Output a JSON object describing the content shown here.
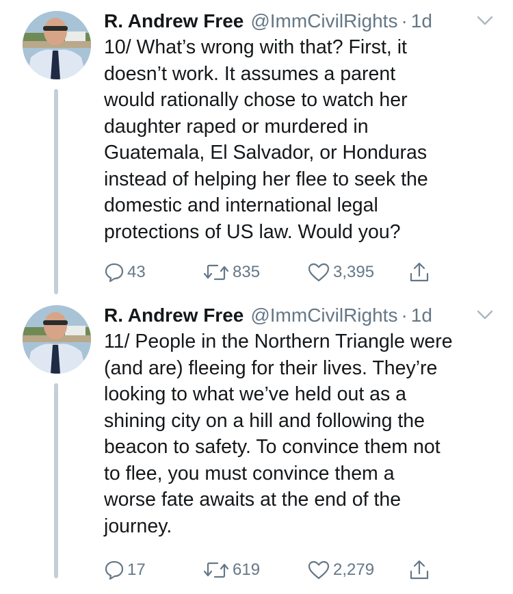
{
  "colors": {
    "text": "#14171a",
    "secondary": "#657786",
    "thread_line": "#c4cfd6"
  },
  "tweets": [
    {
      "author": {
        "name": "R. Andrew Free",
        "handle": "@ImmCivilRights",
        "avatar_icon": "profile-photo"
      },
      "separator": "·",
      "time": "1d",
      "text": "10/ What’s wrong with that? First, it\ndoesn’t work. It assumes a parent\nwould rationally chose to watch her\ndaughter raped or murdered in\nGuatemala, El Salvador, or Honduras\ninstead of helping her flee to seek the\ndomestic and international legal\nprotections of US law. Would you?",
      "replies": "43",
      "retweets": "835",
      "likes": "3,395"
    },
    {
      "author": {
        "name": "R. Andrew Free",
        "handle": "@ImmCivilRights",
        "avatar_icon": "profile-photo"
      },
      "separator": "·",
      "time": "1d",
      "text": "11/ People in the Northern Triangle were\n(and are) fleeing for their lives. They’re\nlooking to what we’ve held out as a\nshining city on a hill and following the\nbeacon to safety. To convince them not\nto flee, you must convince them a\nworse fate awaits at the end of the\njourney.",
      "replies": "17",
      "retweets": "619",
      "likes": "2,279"
    }
  ],
  "icons": {
    "menu": "chevron-down-icon",
    "reply": "reply-icon",
    "retweet": "retweet-icon",
    "like": "heart-icon",
    "share": "share-icon"
  }
}
